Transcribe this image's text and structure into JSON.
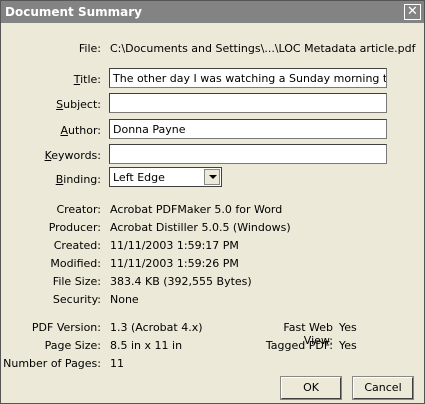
{
  "window": {
    "title": "Document Summary",
    "close_glyph": "✕"
  },
  "file": {
    "label": "File:",
    "value": "C:\\Documents and Settings\\...\\LOC Metadata article.pdf"
  },
  "fields": {
    "title": {
      "label": "Title:",
      "value": "The other day I was watching a Sunday morning talking heads po"
    },
    "subject": {
      "label": "Subject:",
      "value": ""
    },
    "author": {
      "label": "Author:",
      "value": "Donna Payne"
    },
    "keywords": {
      "label": "Keywords:",
      "value": ""
    }
  },
  "binding": {
    "label": "Binding:",
    "value": "Left Edge"
  },
  "info": {
    "creator": {
      "label": "Creator:",
      "value": "Acrobat PDFMaker 5.0 for Word"
    },
    "producer": {
      "label": "Producer:",
      "value": "Acrobat Distiller 5.0.5 (Windows)"
    },
    "created": {
      "label": "Created:",
      "value": "11/11/2003 1:59:17 PM"
    },
    "modified": {
      "label": "Modified:",
      "value": "11/11/2003 1:59:26 PM"
    },
    "file_size": {
      "label": "File Size:",
      "value": "383.4 KB (392,555 Bytes)"
    },
    "security": {
      "label": "Security:",
      "value": "None"
    }
  },
  "pdf": {
    "version": {
      "label": "PDF Version:",
      "value": "1.3 (Acrobat 4.x)"
    },
    "page_size": {
      "label": "Page Size:",
      "value": "8.5 in x 11 in"
    },
    "num_pages": {
      "label": "Number of Pages:",
      "value": "11"
    },
    "fast_web_view": {
      "label": "Fast Web View:",
      "value": "Yes"
    },
    "tagged_pdf": {
      "label": "Tagged PDF:",
      "value": "Yes"
    }
  },
  "buttons": {
    "ok": "OK",
    "cancel": "Cancel"
  }
}
